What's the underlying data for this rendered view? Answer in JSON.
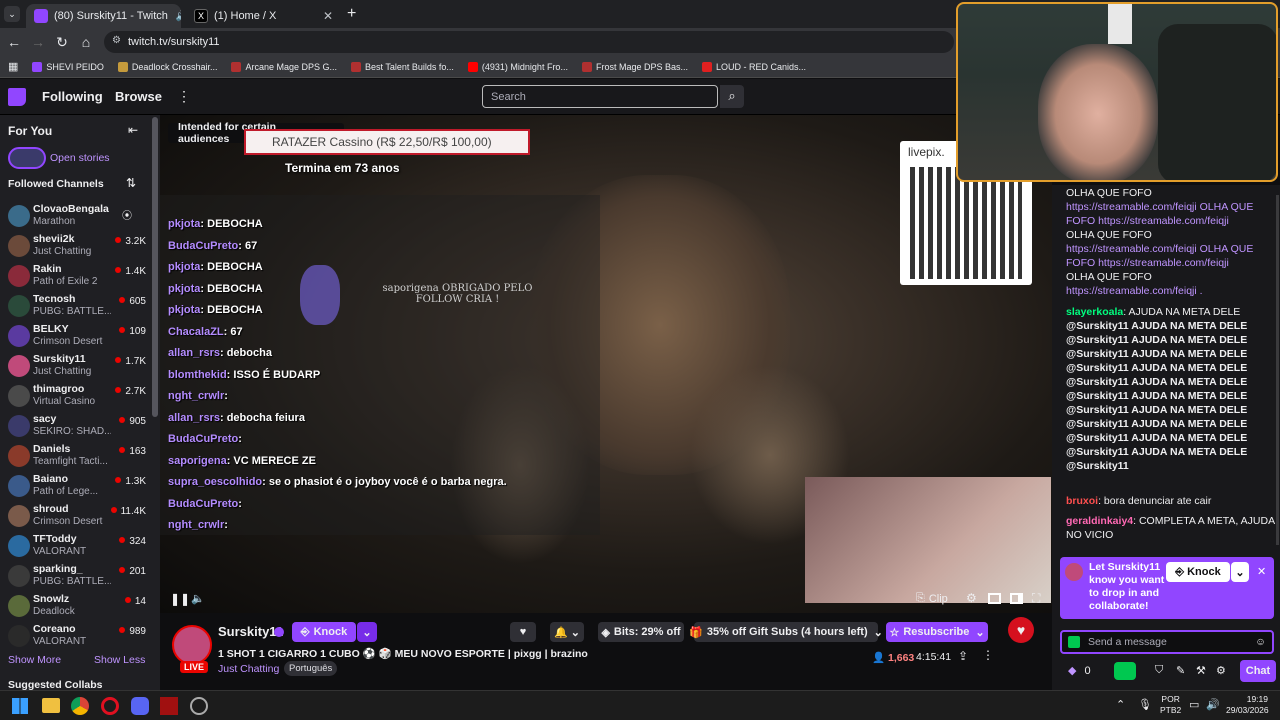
{
  "browser": {
    "tabs": [
      {
        "label": "(80) Surskity11 - Twitch"
      },
      {
        "label": "(1) Home / X"
      }
    ],
    "new_tab": "+",
    "url": "twitch.tv/surskity11",
    "bookmarks": [
      {
        "label": "SHEVI PEIDO",
        "color": "#9146ff"
      },
      {
        "label": "Deadlock Crosshair...",
        "color": "#c49a3c"
      },
      {
        "label": "Arcane Mage DPS G...",
        "color": "#b03030"
      },
      {
        "label": "Best Talent Builds fo...",
        "color": "#b03030"
      },
      {
        "label": "(4931) Midnight Fro...",
        "color": "#ff0000"
      },
      {
        "label": "Frost Mage DPS Bas...",
        "color": "#b03030"
      },
      {
        "label": "LOUD - RED Canids...",
        "color": "#e02020"
      }
    ]
  },
  "twitch_nav": {
    "following": "Following",
    "browse": "Browse",
    "more": "⋮",
    "search_placeholder": "Search"
  },
  "sidebar": {
    "for_you": "For You",
    "open_stories": "Open stories",
    "followed_channels": "Followed Channels",
    "channels": [
      {
        "name": "ClovaoBengala",
        "game": "Marathon",
        "viewers": "",
        "color": "#3a6b8a"
      },
      {
        "name": "shevii2k",
        "game": "Just Chatting",
        "viewers": "3.2K",
        "color": "#6b4a3a"
      },
      {
        "name": "Rakin",
        "game": "Path of Exile 2",
        "viewers": "1.4K",
        "color": "#8a2a3a"
      },
      {
        "name": "Tecnosh",
        "game": "PUBG: BATTLE...",
        "viewers": "605",
        "color": "#2a4a3a"
      },
      {
        "name": "BELKY",
        "game": "Crimson Desert",
        "viewers": "109",
        "color": "#5a3aa0"
      },
      {
        "name": "Surskity11",
        "game": "Just Chatting",
        "viewers": "1.7K",
        "color": "#c04a7a"
      },
      {
        "name": "thimagroo",
        "game": "Virtual Casino",
        "viewers": "2.7K",
        "color": "#4a4a4a"
      },
      {
        "name": "sacy",
        "game": "SEKIRO: SHAD...",
        "viewers": "905",
        "color": "#3a3a6a"
      },
      {
        "name": "Daniels",
        "game": "Teamfight Tacti...",
        "viewers": "163",
        "color": "#8a3a2a"
      },
      {
        "name": "Baiano",
        "game": "Path of Lege...",
        "viewers": "1.3K",
        "color": "#3a5a8a"
      },
      {
        "name": "shroud",
        "game": "Crimson Desert",
        "viewers": "11.4K",
        "color": "#7a5a4a"
      },
      {
        "name": "TFToddy",
        "game": "VALORANT",
        "viewers": "324",
        "color": "#2a6aa0"
      },
      {
        "name": "sparking_",
        "game": "PUBG: BATTLE...",
        "viewers": "201",
        "color": "#3a3a3a"
      },
      {
        "name": "Snowlz",
        "game": "Deadlock",
        "viewers": "14",
        "color": "#5a6a3a"
      },
      {
        "name": "Coreano",
        "game": "VALORANT",
        "viewers": "989",
        "color": "#2a2a2a"
      }
    ],
    "show_more": "Show More",
    "show_less": "Show Less",
    "suggested": "Suggested Collabs"
  },
  "player": {
    "audience_badge": "Intended for certain audiences",
    "banner_text": "RATAZER Cassino (R$ 22,50/R$ 100,00)",
    "countdown": "Termina em 73 anos",
    "qr_label": "livepix.",
    "overlay_follow": "saporigena OBRIGADO PELO FOLLOW CRIA !",
    "overlay_chat": [
      {
        "user": "pkjota",
        "msg": ": DEBOCHA",
        "color": "#b48cff"
      },
      {
        "user": "BudaCuPreto",
        "msg": ": 67",
        "color": "#b48cff"
      },
      {
        "user": "pkjota",
        "msg": ": DEBOCHA",
        "color": "#b48cff"
      },
      {
        "user": "pkjota",
        "msg": ": DEBOCHA",
        "color": "#b48cff"
      },
      {
        "user": "pkjota",
        "msg": ": DEBOCHA",
        "color": "#b48cff"
      },
      {
        "user": "ChacalaZL",
        "msg": ": 67",
        "color": "#b48cff"
      },
      {
        "user": "allan_rsrs",
        "msg": ": debocha",
        "color": "#b48cff"
      },
      {
        "user": "blomthekid",
        "msg": ": ISSO É BUDARP",
        "color": "#b48cff"
      },
      {
        "user": "nght_crwlr",
        "msg": ":",
        "color": "#b48cff"
      },
      {
        "user": "allan_rsrs",
        "msg": ": debocha feiura",
        "color": "#b48cff"
      },
      {
        "user": "BudaCuPreto",
        "msg": ":",
        "color": "#b48cff"
      },
      {
        "user": "saporigena",
        "msg": ": VC MERECE ZE",
        "color": "#b48cff"
      },
      {
        "user": "supra_oescolhido",
        "msg": ": se o phasiot é o joyboy você é o barba negra.",
        "color": "#b48cff"
      },
      {
        "user": "BudaCuPreto",
        "msg": ":",
        "color": "#b48cff"
      },
      {
        "user": "nght_crwlr",
        "msg": ":",
        "color": "#b48cff"
      }
    ],
    "clip": "Clip"
  },
  "stream_info": {
    "channel": "Surskity11",
    "knock": "Knock",
    "title": "1 SHOT 1 CIGARRO 1 CUBO ⚽ 🎲 MEU NOVO ESPORTE",
    "tags_inline": [
      "pixgg",
      "brazino"
    ],
    "category": "Just Chatting",
    "tag": "Português",
    "live": "LIVE",
    "bits": "Bits: 29% off",
    "gift_subs": "35% off Gift Subs (4 hours left)",
    "resubscribe": "Resubscribe",
    "viewers": "1,663",
    "uptime": "4:15:41"
  },
  "chat": {
    "messages_top": [
      "OLHA QUE FOFO",
      "https://streamable.com/feiqji  OLHA QUE FOFO https://streamable.com/feiqji",
      "OLHA QUE FOFO",
      "https://streamable.com/feiqji  OLHA QUE FOFO https://streamable.com/feiqji",
      "OLHA QUE FOFO",
      "https://streamable.com/feiqji ."
    ],
    "slayer_user": "slayerkoala",
    "slayer_msg": ": AJUDA NA META DELE",
    "repeat_line": "@Surskity11 AJUDA NA META DELE",
    "repeat_count_label": "@Surskity11",
    "bruxoi_user": "bruxoi",
    "bruxoi_msg": ": bora denunciar ate cair",
    "gerald_user": "geraldinkaiy4",
    "gerald_msg": ": COMPLETA A META, AJUDA NO VICIO",
    "collab_text": "Let Surskity11 know you want to drop in and collaborate!",
    "collab_knock": "Knock",
    "send_placeholder": "Send a message",
    "points": "0",
    "chat_button": "Chat"
  },
  "taskbar": {
    "lang": "POR",
    "lang2": "PTB2",
    "time": "19:19",
    "date": "29/03/2026"
  },
  "colors": {
    "twitch_purple": "#9146ff",
    "live_red": "#eb0400",
    "webcam_border": "#e39e2b"
  }
}
